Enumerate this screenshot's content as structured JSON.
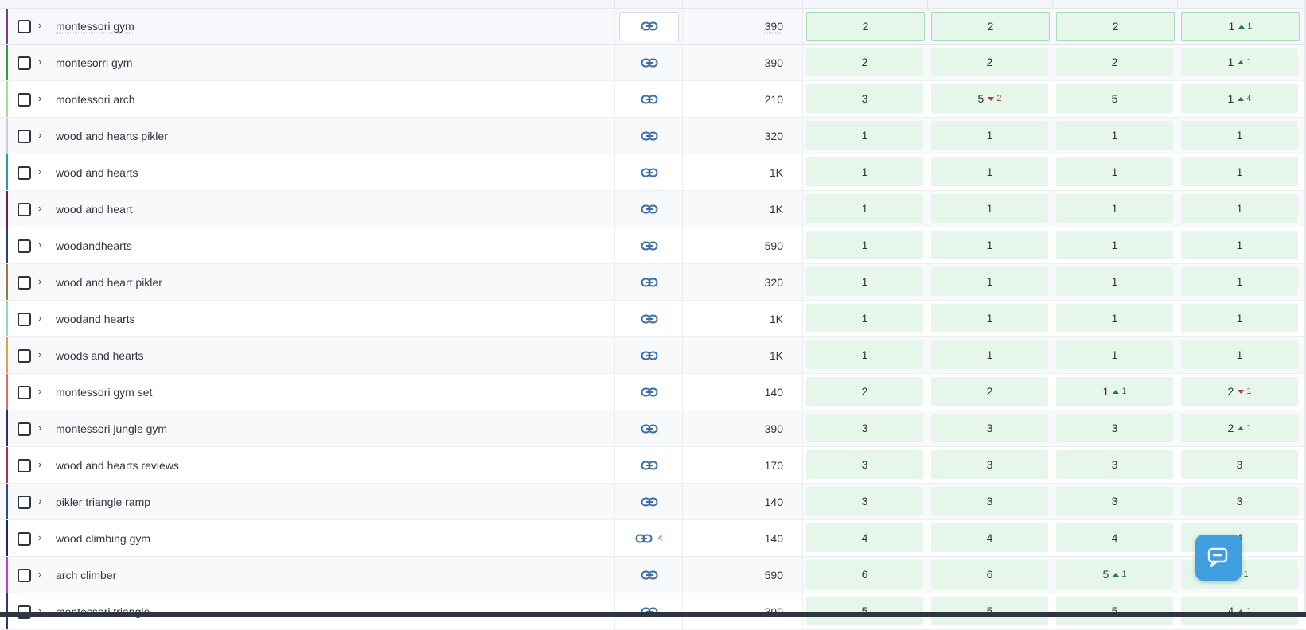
{
  "colors": {
    "position_bg": "#e6f6ea",
    "up_change": "#2d7a3e",
    "down_change": "#c0392b",
    "chat_button": "#3f9fe0"
  },
  "icons": {
    "row_expand": "chevron-right-icon",
    "url_link": "link-icon",
    "chat": "chat-icon"
  },
  "chevron_glyph": "›",
  "rows": [
    {
      "keyword": "montessori gym",
      "accent": "#7b3a8a",
      "volume": "390",
      "link_badge": "",
      "positions": [
        {
          "value": "2",
          "change": "",
          "dir": ""
        },
        {
          "value": "2",
          "change": "",
          "dir": ""
        },
        {
          "value": "2",
          "change": "",
          "dir": ""
        },
        {
          "value": "1",
          "change": "1",
          "dir": "up"
        }
      ]
    },
    {
      "keyword": "montesorri gym",
      "accent": "#2e9b45",
      "volume": "390",
      "link_badge": "",
      "positions": [
        {
          "value": "2",
          "change": "",
          "dir": ""
        },
        {
          "value": "2",
          "change": "",
          "dir": ""
        },
        {
          "value": "2",
          "change": "",
          "dir": ""
        },
        {
          "value": "1",
          "change": "1",
          "dir": "up"
        }
      ]
    },
    {
      "keyword": "montessori arch",
      "accent": "#9fe0a2",
      "volume": "210",
      "link_badge": "",
      "positions": [
        {
          "value": "3",
          "change": "",
          "dir": ""
        },
        {
          "value": "5",
          "change": "2",
          "dir": "down"
        },
        {
          "value": "5",
          "change": "",
          "dir": ""
        },
        {
          "value": "1",
          "change": "4",
          "dir": "up"
        }
      ]
    },
    {
      "keyword": "wood and hearts pikler",
      "accent": "#d2c8dc",
      "volume": "320",
      "link_badge": "",
      "positions": [
        {
          "value": "1",
          "change": "",
          "dir": ""
        },
        {
          "value": "1",
          "change": "",
          "dir": ""
        },
        {
          "value": "1",
          "change": "",
          "dir": ""
        },
        {
          "value": "1",
          "change": "",
          "dir": ""
        }
      ]
    },
    {
      "keyword": "wood and hearts",
      "accent": "#1fa39a",
      "volume": "1K",
      "link_badge": "",
      "positions": [
        {
          "value": "1",
          "change": "",
          "dir": ""
        },
        {
          "value": "1",
          "change": "",
          "dir": ""
        },
        {
          "value": "1",
          "change": "",
          "dir": ""
        },
        {
          "value": "1",
          "change": "",
          "dir": ""
        }
      ]
    },
    {
      "keyword": "wood and heart",
      "accent": "#6a1f4a",
      "volume": "1K",
      "link_badge": "",
      "positions": [
        {
          "value": "1",
          "change": "",
          "dir": ""
        },
        {
          "value": "1",
          "change": "",
          "dir": ""
        },
        {
          "value": "1",
          "change": "",
          "dir": ""
        },
        {
          "value": "1",
          "change": "",
          "dir": ""
        }
      ]
    },
    {
      "keyword": "woodandhearts",
      "accent": "#2c3e7a",
      "volume": "590",
      "link_badge": "",
      "positions": [
        {
          "value": "1",
          "change": "",
          "dir": ""
        },
        {
          "value": "1",
          "change": "",
          "dir": ""
        },
        {
          "value": "1",
          "change": "",
          "dir": ""
        },
        {
          "value": "1",
          "change": "",
          "dir": ""
        }
      ]
    },
    {
      "keyword": "wood and heart pikler",
      "accent": "#9a7a3a",
      "volume": "320",
      "link_badge": "",
      "positions": [
        {
          "value": "1",
          "change": "",
          "dir": ""
        },
        {
          "value": "1",
          "change": "",
          "dir": ""
        },
        {
          "value": "1",
          "change": "",
          "dir": ""
        },
        {
          "value": "1",
          "change": "",
          "dir": ""
        }
      ]
    },
    {
      "keyword": "woodand hearts",
      "accent": "#8fd8d0",
      "volume": "1K",
      "link_badge": "",
      "positions": [
        {
          "value": "1",
          "change": "",
          "dir": ""
        },
        {
          "value": "1",
          "change": "",
          "dir": ""
        },
        {
          "value": "1",
          "change": "",
          "dir": ""
        },
        {
          "value": "1",
          "change": "",
          "dir": ""
        }
      ]
    },
    {
      "keyword": "woods and hearts",
      "accent": "#d8a44a",
      "volume": "1K",
      "link_badge": "",
      "positions": [
        {
          "value": "1",
          "change": "",
          "dir": ""
        },
        {
          "value": "1",
          "change": "",
          "dir": ""
        },
        {
          "value": "1",
          "change": "",
          "dir": ""
        },
        {
          "value": "1",
          "change": "",
          "dir": ""
        }
      ]
    },
    {
      "keyword": "montessori gym set",
      "accent": "#e06a6a",
      "volume": "140",
      "link_badge": "",
      "positions": [
        {
          "value": "2",
          "change": "",
          "dir": ""
        },
        {
          "value": "2",
          "change": "",
          "dir": ""
        },
        {
          "value": "1",
          "change": "1",
          "dir": "up"
        },
        {
          "value": "2",
          "change": "1",
          "dir": "down"
        }
      ]
    },
    {
      "keyword": "montessori jungle gym",
      "accent": "#3a2a6a",
      "volume": "390",
      "link_badge": "",
      "positions": [
        {
          "value": "3",
          "change": "",
          "dir": ""
        },
        {
          "value": "3",
          "change": "",
          "dir": ""
        },
        {
          "value": "3",
          "change": "",
          "dir": ""
        },
        {
          "value": "2",
          "change": "1",
          "dir": "up"
        }
      ]
    },
    {
      "keyword": "wood and hearts reviews",
      "accent": "#c0284a",
      "volume": "170",
      "link_badge": "",
      "positions": [
        {
          "value": "3",
          "change": "",
          "dir": ""
        },
        {
          "value": "3",
          "change": "",
          "dir": ""
        },
        {
          "value": "3",
          "change": "",
          "dir": ""
        },
        {
          "value": "3",
          "change": "",
          "dir": ""
        }
      ]
    },
    {
      "keyword": "pikler triangle ramp",
      "accent": "#2a4a9a",
      "volume": "140",
      "link_badge": "",
      "positions": [
        {
          "value": "3",
          "change": "",
          "dir": ""
        },
        {
          "value": "3",
          "change": "",
          "dir": ""
        },
        {
          "value": "3",
          "change": "",
          "dir": ""
        },
        {
          "value": "3",
          "change": "",
          "dir": ""
        }
      ]
    },
    {
      "keyword": "wood climbing gym",
      "accent": "#1e2a5a",
      "volume": "140",
      "link_badge": "4",
      "positions": [
        {
          "value": "4",
          "change": "",
          "dir": ""
        },
        {
          "value": "4",
          "change": "",
          "dir": ""
        },
        {
          "value": "4",
          "change": "",
          "dir": ""
        },
        {
          "value": "4",
          "change": "",
          "dir": ""
        }
      ]
    },
    {
      "keyword": "arch climber",
      "accent": "#c83ad0",
      "volume": "590",
      "link_badge": "",
      "positions": [
        {
          "value": "6",
          "change": "",
          "dir": ""
        },
        {
          "value": "6",
          "change": "",
          "dir": ""
        },
        {
          "value": "5",
          "change": "1",
          "dir": "up"
        },
        {
          "value": "",
          "change": "1",
          "dir": "up"
        }
      ]
    },
    {
      "keyword": "montessori triangle",
      "accent": "#2a3a6a",
      "volume": "390",
      "link_badge": "",
      "positions": [
        {
          "value": "5",
          "change": "",
          "dir": ""
        },
        {
          "value": "5",
          "change": "",
          "dir": ""
        },
        {
          "value": "5",
          "change": "",
          "dir": ""
        },
        {
          "value": "4",
          "change": "1",
          "dir": "up"
        }
      ]
    }
  ]
}
